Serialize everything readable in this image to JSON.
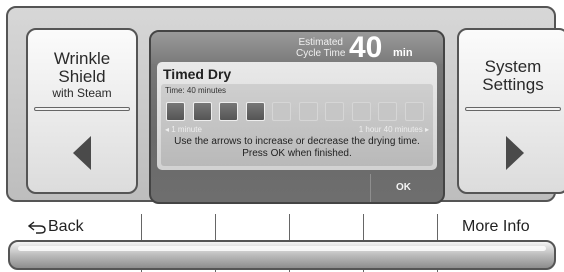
{
  "left_button": {
    "line1": "Wrinkle",
    "line2": "Shield",
    "line3": "with Steam",
    "arrow_icon": "left-arrow"
  },
  "right_button": {
    "line1": "System",
    "line2": "Settings",
    "arrow_icon": "right-arrow"
  },
  "screen": {
    "estimated_label_1": "Estimated",
    "estimated_label_2": "Cycle Time",
    "cycle_time_value": "40",
    "cycle_time_unit": "min",
    "title": "Timed Dry",
    "time_label": "Time: 40 minutes",
    "range_min": "◂ 1 minute",
    "range_max": "1 hour 40 minutes ▸",
    "instruction_1": "Use the arrows to increase or decrease the drying time.",
    "instruction_2": "Press OK when finished.",
    "ok_label": "OK",
    "time_blocks_total": 10,
    "time_blocks_filled": 4
  },
  "soft_keys": {
    "back_label": "Back",
    "back_icon": "back-arrow-icon",
    "more_info_label": "More Info"
  }
}
